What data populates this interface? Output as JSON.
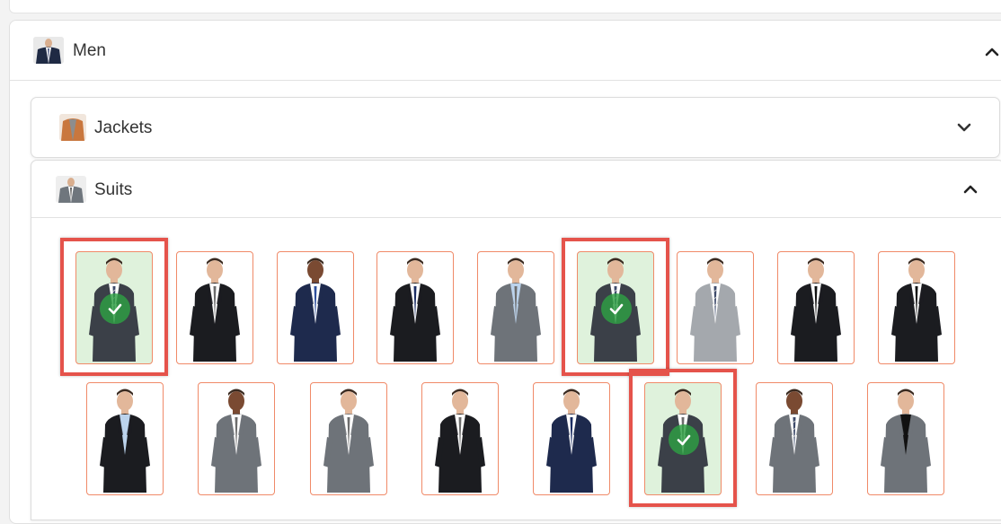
{
  "men": {
    "label": "Men",
    "thumb_icon": "man-in-suit-thumbnail",
    "expanded": true
  },
  "jackets": {
    "label": "Jackets",
    "thumb_icon": "jacket-thumbnail",
    "expanded": false
  },
  "suits": {
    "label": "Suits",
    "thumb_icon": "suit-thumbnail",
    "expanded": true,
    "items": [
      {
        "suit": "dark grey",
        "shirt": "white",
        "tie": "striped",
        "skin": "light",
        "selected": true
      },
      {
        "suit": "black",
        "shirt": "white",
        "tie": "grey",
        "skin": "light",
        "selected": false
      },
      {
        "suit": "navy",
        "shirt": "white",
        "tie": "blue",
        "skin": "dark",
        "selected": false
      },
      {
        "suit": "black",
        "shirt": "white",
        "tie": "navy",
        "skin": "light",
        "selected": false
      },
      {
        "suit": "grey",
        "shirt": "light blue",
        "tie": "grey",
        "skin": "light",
        "selected": false
      },
      {
        "suit": "dark grey",
        "shirt": "white",
        "tie": "striped",
        "skin": "light",
        "selected": true
      },
      {
        "suit": "light grey",
        "shirt": "white",
        "tie": "striped",
        "skin": "light",
        "selected": false
      },
      {
        "suit": "black",
        "shirt": "white",
        "tie": "black",
        "skin": "light",
        "selected": false
      },
      {
        "suit": "black",
        "shirt": "white",
        "tie": "black",
        "skin": "light",
        "selected": false
      },
      {
        "suit": "black",
        "shirt": "light blue",
        "tie": "none",
        "skin": "light",
        "selected": false
      },
      {
        "suit": "grey",
        "shirt": "white",
        "tie": "grey",
        "skin": "dark",
        "selected": false
      },
      {
        "suit": "grey",
        "shirt": "white",
        "tie": "grey",
        "skin": "light",
        "selected": false
      },
      {
        "suit": "black",
        "shirt": "white",
        "tie": "grey",
        "skin": "light",
        "selected": false
      },
      {
        "suit": "navy",
        "shirt": "white",
        "tie": "navy",
        "skin": "light",
        "selected": false
      },
      {
        "suit": "dark grey",
        "shirt": "white",
        "tie": "grey",
        "skin": "light",
        "selected": true
      },
      {
        "suit": "grey",
        "shirt": "white",
        "tie": "striped",
        "skin": "dark",
        "selected": false
      },
      {
        "suit": "grey",
        "shirt": "black",
        "tie": "none",
        "skin": "light",
        "selected": false
      }
    ]
  },
  "icons": {
    "expanded": "chevron-up-icon",
    "collapsed": "chevron-down-icon",
    "selected": "check-circle-icon"
  },
  "colors": {
    "card_border": "#f08a68",
    "selected_bg": "#dff2dc",
    "check_bg": "#2ea043",
    "highlight": "#e5534b"
  }
}
